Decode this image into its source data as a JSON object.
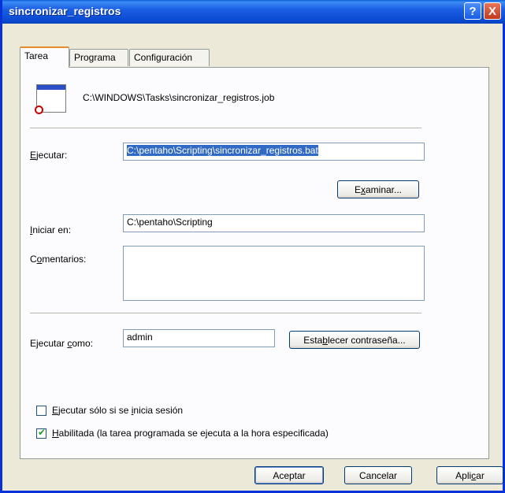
{
  "window": {
    "title": "sincronizar_registros",
    "help_glyph": "?",
    "close_glyph": "X"
  },
  "tabs": [
    {
      "label": "Tarea",
      "active": true
    },
    {
      "label": "Programa",
      "active": false
    },
    {
      "label": "Configuración",
      "active": false
    }
  ],
  "task": {
    "path": "C:\\WINDOWS\\Tasks\\sincronizar_registros.job",
    "icon": "scheduled-task-icon"
  },
  "run": {
    "label_pre": "",
    "label_key": "E",
    "label_post": "jecutar:",
    "value": "C:\\pentaho\\Scripting\\sincronizar_registros.bat",
    "browse_pre": "E",
    "browse_key": "x",
    "browse_post": "aminar..."
  },
  "start_in": {
    "label_key": "I",
    "label_post": "niciar en:",
    "value": "C:\\pentaho\\Scripting"
  },
  "comments": {
    "label_pre": "C",
    "label_key": "o",
    "label_post": "mentarios:",
    "value": ""
  },
  "run_as": {
    "label_pre": "Ejecutar ",
    "label_key": "c",
    "label_post": "omo:",
    "value": "admin",
    "password_pre": "Esta",
    "password_key": "b",
    "password_post": "lecer contraseña..."
  },
  "options": {
    "logged_on": {
      "label_pre": "",
      "label_key": "E",
      "label_mid": "jecutar sólo si se ",
      "label_key2": "i",
      "label_post": "nicia sesión",
      "checked": false
    },
    "enabled": {
      "label_key": "H",
      "label_post": "abilitada (la tarea programada se ejecuta a la hora especificada)",
      "checked": true
    }
  },
  "footer": {
    "ok_label": "Aceptar",
    "cancel_label": "Cancelar",
    "apply_pre": "Apli",
    "apply_key": "c",
    "apply_post": "ar"
  },
  "colors": {
    "titlebar": "#0a49d0",
    "selection": "#316ac5",
    "tab_accent": "#e68b2c"
  }
}
